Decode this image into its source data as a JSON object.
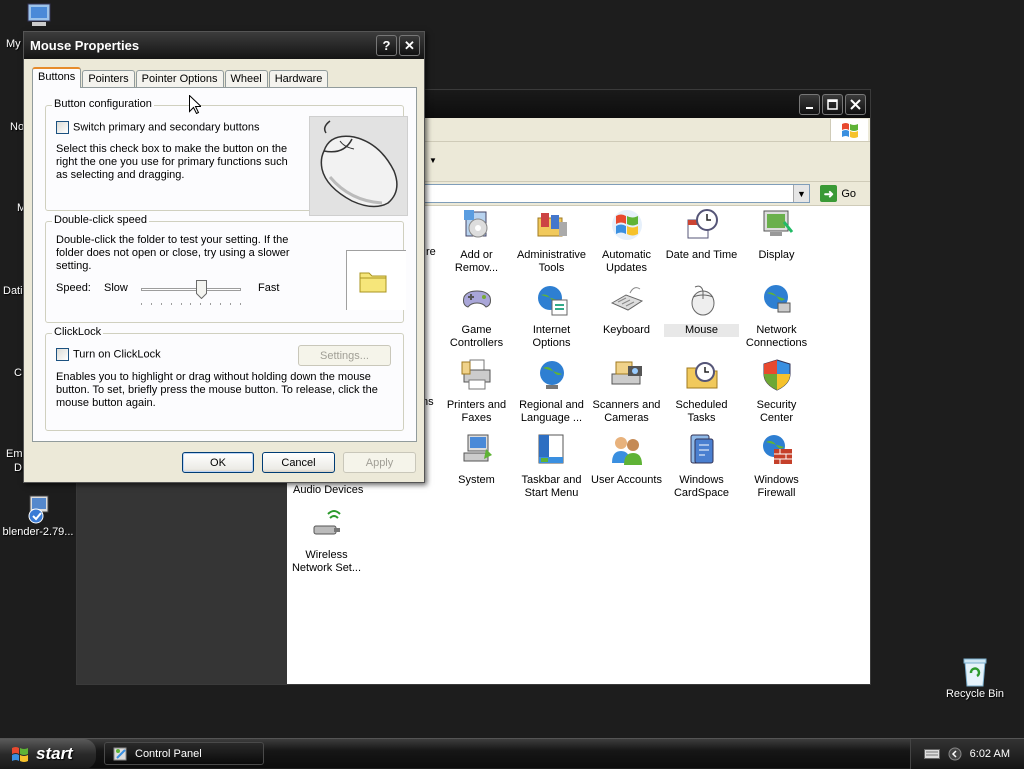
{
  "desktop": {
    "icons": {
      "my_computer": "My",
      "network": "No",
      "media": "M",
      "data": "Dati",
      "c": "C",
      "emule_1": "Em",
      "emule_2": "D",
      "blender": "blender-2.79...",
      "recycle_bin": "Recycle Bin"
    }
  },
  "control_panel": {
    "address_go": "Go",
    "left_partial": {
      "re": "re",
      "ns": "ns",
      "audio_devices": "Audio Devices"
    },
    "items": [
      {
        "id": "add-remove",
        "label": "Add or Remov...",
        "icon": "add-remove-programs-icon"
      },
      {
        "id": "admin-tools",
        "label": "Administrative Tools",
        "icon": "administrative-tools-icon"
      },
      {
        "id": "auto-updates",
        "label": "Automatic Updates",
        "icon": "automatic-updates-icon"
      },
      {
        "id": "date-time",
        "label": "Date and Time",
        "icon": "date-time-icon"
      },
      {
        "id": "display",
        "label": "Display",
        "icon": "display-icon"
      },
      {
        "id": "game-controllers",
        "label": "Game Controllers",
        "icon": "game-controller-icon"
      },
      {
        "id": "internet-options",
        "label": "Internet Options",
        "icon": "internet-options-icon"
      },
      {
        "id": "keyboard",
        "label": "Keyboard",
        "icon": "keyboard-icon"
      },
      {
        "id": "mouse",
        "label": "Mouse",
        "icon": "mouse-icon"
      },
      {
        "id": "network-connections",
        "label": "Network Connections",
        "icon": "network-connections-icon"
      },
      {
        "id": "printers-faxes",
        "label": "Printers and Faxes",
        "icon": "printer-icon"
      },
      {
        "id": "regional-language",
        "label": "Regional and Language ...",
        "icon": "globe-icon"
      },
      {
        "id": "scanners-cameras",
        "label": "Scanners and Cameras",
        "icon": "scanner-icon"
      },
      {
        "id": "scheduled-tasks",
        "label": "Scheduled Tasks",
        "icon": "scheduled-tasks-icon"
      },
      {
        "id": "security-center",
        "label": "Security Center",
        "icon": "shield-icon"
      },
      {
        "id": "system",
        "label": "System",
        "icon": "system-icon"
      },
      {
        "id": "taskbar-start",
        "label": "Taskbar and Start Menu",
        "icon": "taskbar-icon"
      },
      {
        "id": "user-accounts",
        "label": "User Accounts",
        "icon": "user-accounts-icon"
      },
      {
        "id": "cardspace",
        "label": "Windows CardSpace",
        "icon": "cardspace-icon"
      },
      {
        "id": "firewall",
        "label": "Windows Firewall",
        "icon": "firewall-icon"
      },
      {
        "id": "wireless",
        "label": "Wireless Network Set...",
        "icon": "wireless-icon"
      }
    ]
  },
  "dialog": {
    "title": "Mouse Properties",
    "help_glyph": "?",
    "close_glyph": "✕",
    "tabs": [
      "Buttons",
      "Pointers",
      "Pointer Options",
      "Wheel",
      "Hardware"
    ],
    "active_tab": "Buttons",
    "button_config": {
      "title": "Button configuration",
      "checkbox_label": "Switch primary and secondary buttons",
      "description_1": "Select this check box to make the button on the",
      "description_2": "right the one you use for primary functions such",
      "description_3": "as selecting and dragging."
    },
    "double_click": {
      "title": "Double-click speed",
      "description_1": "Double-click the folder to test your setting. If the",
      "description_2": "folder does not open or close, try using a slower",
      "description_3": "setting.",
      "speed_label": "Speed:",
      "slow_label": "Slow",
      "fast_label": "Fast",
      "speed_fraction": 0.6
    },
    "clicklock": {
      "title": "ClickLock",
      "checkbox_label": "Turn on ClickLock",
      "settings_button": "Settings...",
      "description_1": "Enables you to highlight or drag without holding down the mouse",
      "description_2": "button. To set, briefly press the mouse button. To release, click the",
      "description_3": "mouse button again."
    },
    "buttons": {
      "ok": "OK",
      "cancel": "Cancel",
      "apply": "Apply"
    }
  },
  "taskbar": {
    "start_label": "start",
    "task_label": "Control Panel",
    "clock": "6:02 AM"
  }
}
